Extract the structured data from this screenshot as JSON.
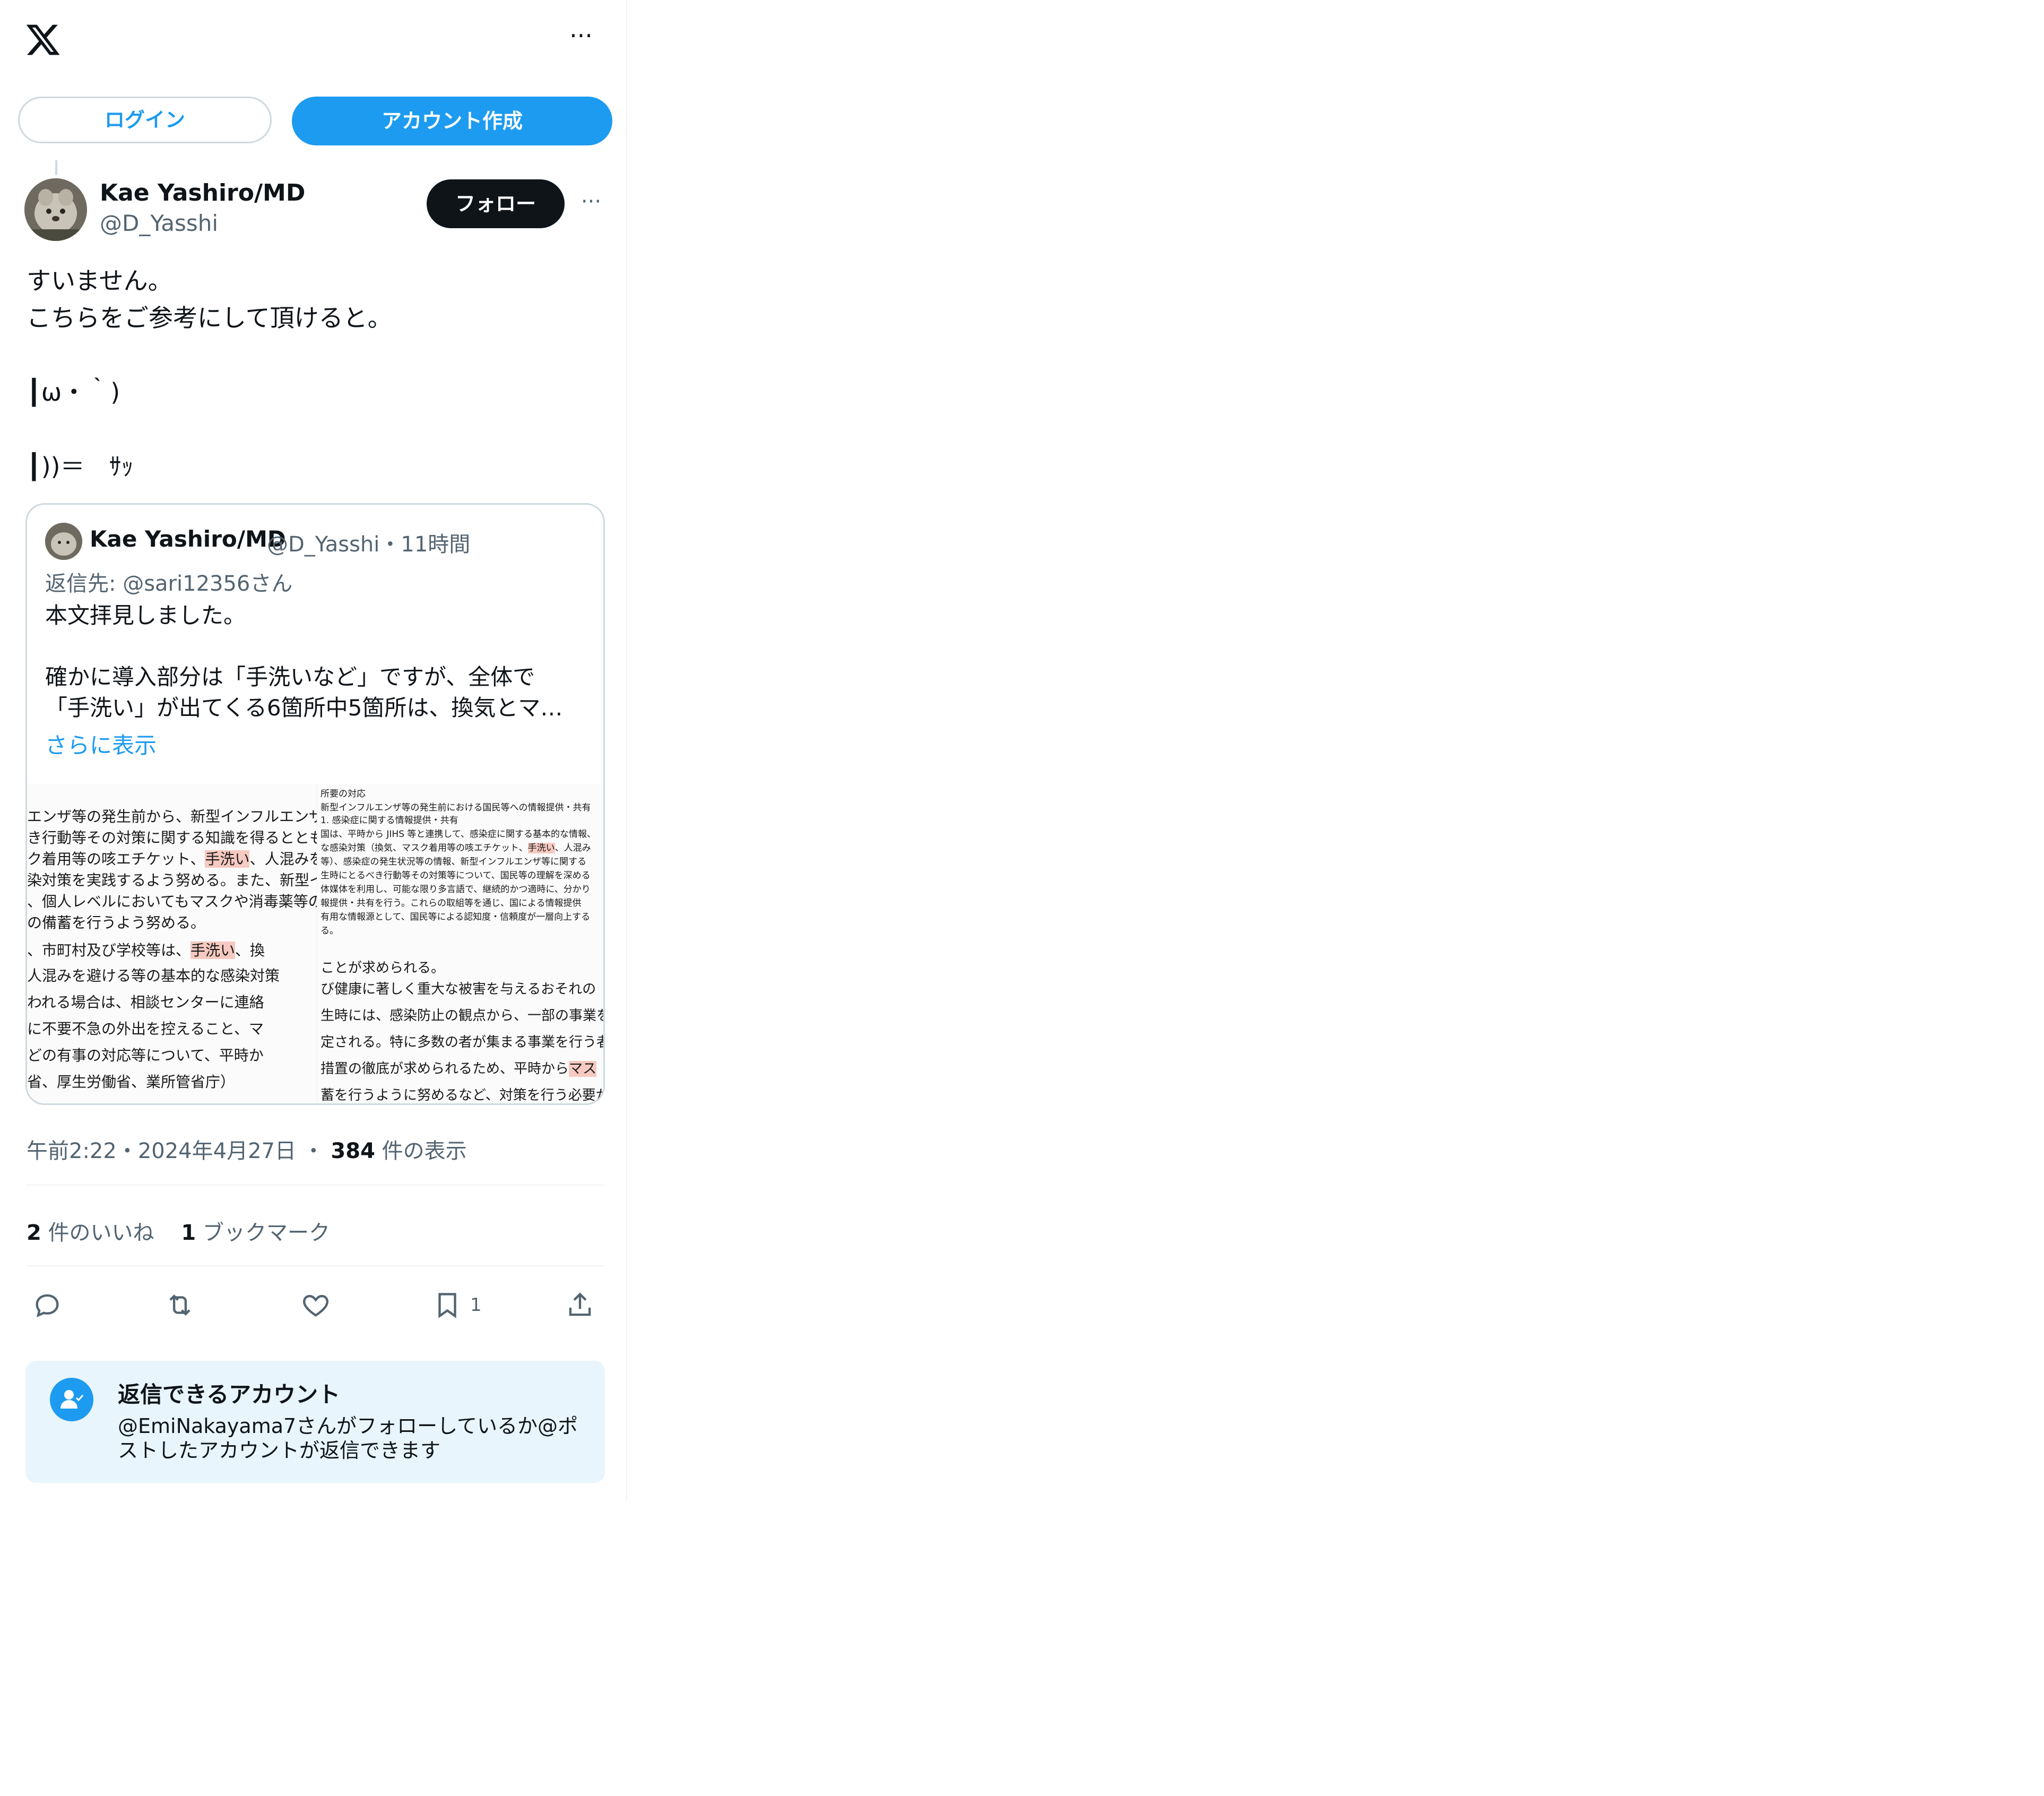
{
  "header": {
    "logo": "x-logo-icon",
    "more": "···"
  },
  "auth": {
    "login": "ログイン",
    "signup": "アカウント作成"
  },
  "tweet": {
    "author_name": "Kae Yashiro/MD",
    "author_handle": "@D_Yasshi",
    "follow": "フォロー",
    "more": "···",
    "text": "すいません。\nこちらをご参考にして頂けると。\n\n┃ω・｀)\n\n┃))＝　ｻｯ"
  },
  "quote": {
    "author_name": "Kae Yashiro/MD",
    "author_handle": "@D_Yasshi",
    "sep": "・",
    "time": "11時間",
    "reply_prefix": "返信先: ",
    "reply_to": "@sari12356さん",
    "text": "本文拝見しました。\n\n確かに導入部分は「手洗いなど」ですが、全体で\n「手洗い」が出てくる6箇所中5箇所は、換気とマ…",
    "show_more": "さらに表示",
    "image_left": [
      {
        "text": "エンザ等の発生前から、新型インフルエンザ",
        "hl": ""
      },
      {
        "text": "き行動等その対策に関する知識を得るととも",
        "hl": ""
      },
      {
        "text": "ク着用等の咳エチケット、",
        "hl": "手洗い",
        "rest": "、人混みを"
      },
      {
        "text": "染対策を実践するよう努める。また、新型イ",
        "hl": ""
      },
      {
        "text": "、個人レベルにおいてもマスクや消毒薬等の",
        "hl": ""
      },
      {
        "text": "の備蓄を行うよう努める。",
        "hl": ""
      },
      {
        "text": "、市町村及び学校等は、",
        "hl": "手洗い",
        "rest": "、換"
      },
      {
        "text": "人混みを避ける等の基本的な感染対策",
        "hl": ""
      },
      {
        "text": "われる場合は、相談センターに連絡",
        "hl": ""
      },
      {
        "text": "に不要不急の外出を控えること、マ",
        "hl": ""
      },
      {
        "text": "どの有事の対応等について、平時か",
        "hl": ""
      },
      {
        "text": "省、厚生労働省、業所管省庁）",
        "hl": ""
      }
    ],
    "image_right": [
      {
        "text": "所要の対応",
        "hl": ""
      },
      {
        "text": "新型インフルエンザ等の発生前における国民等への情報提供・共有",
        "hl": ""
      },
      {
        "text": "1. 感染症に関する情報提供・共有",
        "hl": ""
      },
      {
        "text": "国は、平時から JIHS 等と連携して、感染症に関する基本的な情報、",
        "hl": ""
      },
      {
        "text": "な感染対策（換気、マスク着用等の咳エチケット、",
        "hl": "手洗い",
        "rest": "、人混み"
      },
      {
        "text": "等）、感染症の発生状況等の情報、新型インフルエンザ等に関する",
        "hl": ""
      },
      {
        "text": "生時にとるべき行動等その対策等について、国民等の理解を深める",
        "hl": ""
      },
      {
        "text": "体媒体を利用し、可能な限り多言語で、継続的かつ適時に、分かり",
        "hl": ""
      },
      {
        "text": "報提供・共有を行う。これらの取組等を通じ、国による情報提供",
        "hl": ""
      },
      {
        "text": "有用な情報源として、国民等による認知度・信頼度が一層向上する",
        "hl": ""
      },
      {
        "text": "る。",
        "hl": ""
      },
      {
        "text": "ことが求められる。",
        "hl": ""
      },
      {
        "text": "び健康に著しく重大な被害を与えるおそれの",
        "hl": ""
      },
      {
        "text": "生時には、感染防止の観点から、一部の事業を",
        "hl": ""
      },
      {
        "text": "定される。特に多数の者が集まる事業を行う者",
        "hl": ""
      },
      {
        "text": "措置の徹底が求められるため、平時から",
        "hl": "マス",
        "rest": ""
      },
      {
        "text": "蓄を行うように努めるなど、対策を行う必要が",
        "hl": ""
      }
    ]
  },
  "meta": {
    "time": "午前2:22",
    "dot": "・",
    "date": "2024年4月27日",
    "views_count": "384",
    "views_label": "件の表示"
  },
  "stats": {
    "likes_count": "2",
    "likes_label": "件のいいね",
    "bookmarks_count": "1",
    "bookmarks_label": "ブックマーク"
  },
  "actions": {
    "reply_icon": "reply-icon",
    "retweet_icon": "retweet-icon",
    "like_icon": "heart-icon",
    "bookmark_icon": "bookmark-icon",
    "bookmark_count": "1",
    "share_icon": "share-icon"
  },
  "reply_notice": {
    "title": "返信できるアカウント",
    "body": "@EmiNakayama7さんがフォローしているか@ポストしたアカウントが返信できます",
    "icon": "person-check-icon"
  },
  "colors": {
    "accent": "#1d9bf0",
    "text": "#0f1419",
    "secondary": "#536471",
    "notice_bg": "#e8f5fd"
  }
}
